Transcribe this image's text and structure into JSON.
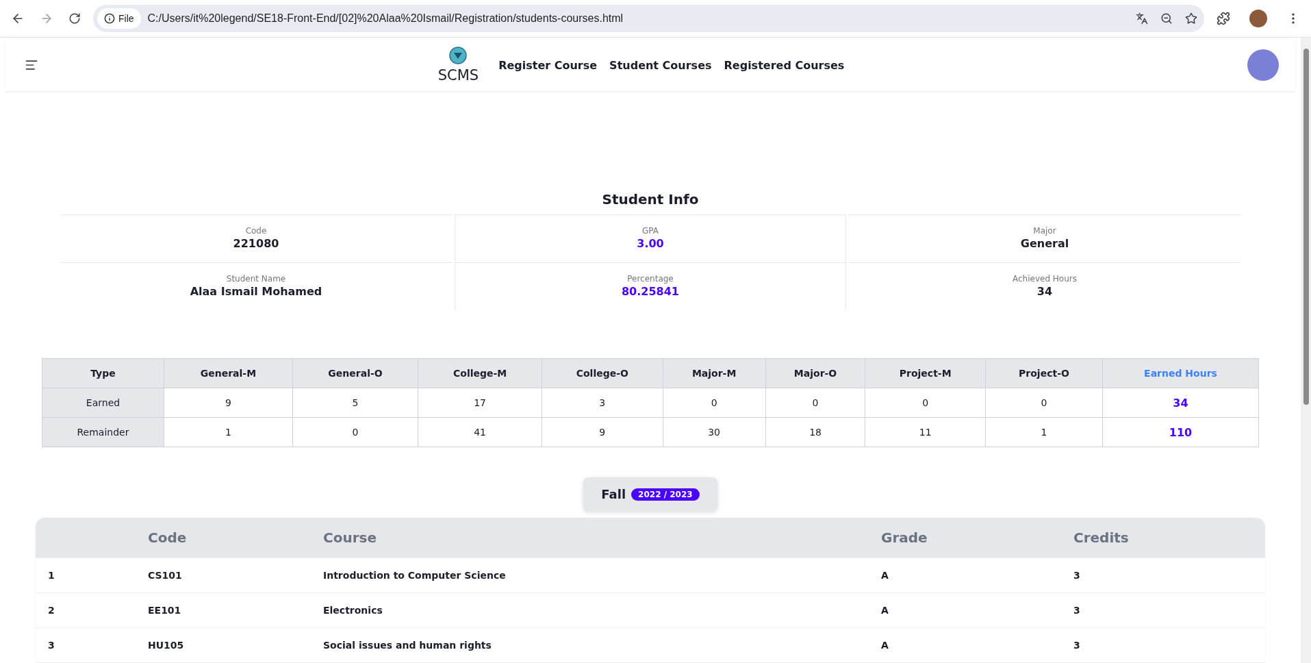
{
  "browser": {
    "file_label": "File",
    "url": "C:/Users/it%20legend/SE18-Front-End/[02]%20Alaa%20Ismail/Registration/students-courses.html"
  },
  "nav": {
    "brand": "SCMS",
    "links": [
      "Register Course",
      "Student Courses",
      "Registered Courses"
    ]
  },
  "student_info": {
    "title": "Student Info",
    "fields": [
      {
        "label": "Code",
        "value": "221080",
        "accent": false
      },
      {
        "label": "GPA",
        "value": "3.00",
        "accent": true
      },
      {
        "label": "Major",
        "value": "General",
        "accent": false
      },
      {
        "label": "Student Name",
        "value": "Alaa Ismail Mohamed",
        "accent": false
      },
      {
        "label": "Percentage",
        "value": "80.25841",
        "accent": true
      },
      {
        "label": "Achieved Hours",
        "value": "34",
        "accent": false
      }
    ]
  },
  "hours_table": {
    "type_heading": "Type",
    "columns": [
      "General-M",
      "General-O",
      "College-M",
      "College-O",
      "Major-M",
      "Major-O",
      "Project-M",
      "Project-O"
    ],
    "total_heading": "Earned Hours",
    "rows": [
      {
        "label": "Earned",
        "values": [
          "9",
          "5",
          "17",
          "3",
          "0",
          "0",
          "0",
          "0"
        ],
        "total": "34"
      },
      {
        "label": "Remainder",
        "values": [
          "1",
          "0",
          "41",
          "9",
          "30",
          "18",
          "11",
          "1"
        ],
        "total": "110"
      }
    ]
  },
  "semester": {
    "term": "Fall",
    "year": "2022 / 2023"
  },
  "courses": {
    "columns": [
      "Code",
      "Course",
      "Grade",
      "Credits"
    ],
    "rows": [
      {
        "number": "1",
        "code": "CS101",
        "course": "Introduction to Computer Science",
        "grade": "A",
        "credits": "3"
      },
      {
        "number": "2",
        "code": "EE101",
        "course": "Electronics",
        "grade": "A",
        "credits": "3"
      },
      {
        "number": "3",
        "code": "HU105",
        "course": "Social issues and human rights",
        "grade": "A",
        "credits": "3"
      }
    ]
  }
}
